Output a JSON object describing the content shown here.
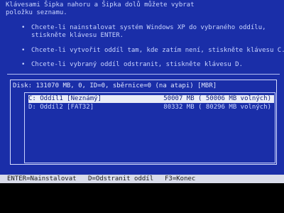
{
  "header": {
    "line1": "Klávesami Šipka nahoru a Šipka dolů můžete vybrat",
    "line2": "položku seznamu."
  },
  "bullets": [
    {
      "line1": "Chcete-li nainstalovat systém Windows XP do vybraného oddílu,",
      "line2": "stiskněte klávesu ENTER."
    },
    {
      "line1": "Chcete-li vytvořit oddíl tam, kde zatím není, stiskněte klávesu C.",
      "line2": ""
    },
    {
      "line1": "Chcete-li vybraný oddíl odstranit, stiskněte klávesu D.",
      "line2": ""
    }
  ],
  "disk": {
    "title": "Disk: 131070 MB, 0, ID=0, sběrnice=0 (na atapi) [MBR]"
  },
  "partitions": [
    {
      "name": "C:  Oddíl1 [Neznámý]",
      "size": "50007 MB ( 50006 MB volných)",
      "selected": true
    },
    {
      "name": "D:  Oddíl2 [FAT32]",
      "size": "80332 MB ( 80296 MB volných)",
      "selected": false
    }
  ],
  "status_bar": {
    "enter": "ENTER=Nainstalovat",
    "delete": "D=Odstranit oddíl",
    "exit": "F3=Konec"
  }
}
